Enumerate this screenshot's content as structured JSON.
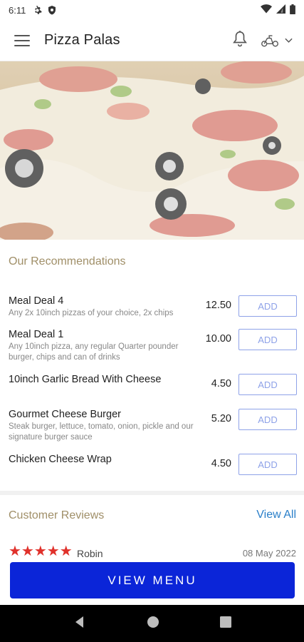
{
  "status_bar": {
    "time": "6:11"
  },
  "header": {
    "title": "Pizza Palas"
  },
  "recommendations": {
    "title": "Our Recommendations",
    "items": [
      {
        "name": "Meal Deal 4",
        "description": "Any 2x 10inch pizzas of your choice, 2x chips",
        "price": "12.50",
        "button": "ADD"
      },
      {
        "name": "Meal Deal 1",
        "description": "Any 10inch  pizza, any regular Quarter pounder burger, chips and can of drinks",
        "price": "10.00",
        "button": "ADD"
      },
      {
        "name": "10inch Garlic Bread With Cheese",
        "description": "",
        "price": "4.50",
        "button": "ADD"
      },
      {
        "name": "Gourmet Cheese Burger",
        "description": "Steak burger, lettuce, tomato, onion, pickle and our signature burger sauce",
        "price": "5.20",
        "button": "ADD"
      },
      {
        "name": "Chicken Cheese Wrap",
        "description": "",
        "price": "4.50",
        "button": "ADD"
      }
    ]
  },
  "reviews": {
    "title": "Customer Reviews",
    "view_all": "View All",
    "first": {
      "stars": "★★★★★",
      "rating": 5,
      "author": "Robin",
      "date": "08 May 2022"
    }
  },
  "cta": {
    "label": "VIEW MENU"
  },
  "colors": {
    "accent": "#0b25d8",
    "add_button": "#8ea2e8",
    "section_title": "#a08f68",
    "link": "#2a7fc9",
    "star": "#e0312b"
  }
}
